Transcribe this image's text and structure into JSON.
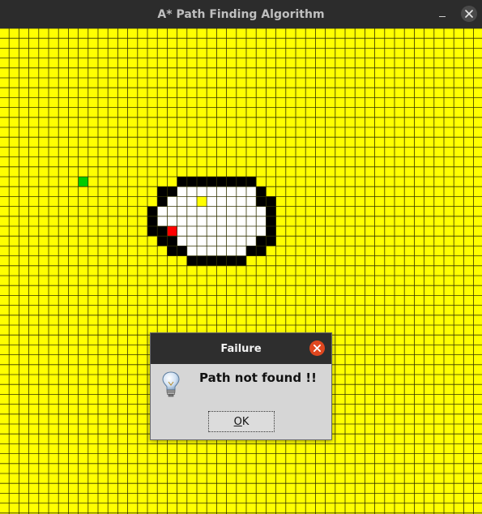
{
  "window": {
    "title": "A* Path Finding Algorithm",
    "minimize_icon": "minimize-icon",
    "close_icon": "close-icon"
  },
  "grid": {
    "cell_colors": {
      "empty": "#ffff00",
      "visited": "#ffffff",
      "wall": "#000000",
      "start": "#00cc00",
      "end": "#ff0000",
      "lines": "#333300"
    },
    "start_cell": [
      15,
      8
    ],
    "end_cell": [
      20,
      17
    ],
    "wall_rows": [
      {
        "row": 15,
        "cols": [
          18,
          19,
          20,
          21,
          22,
          23,
          24,
          25
        ]
      },
      {
        "row": 16,
        "cols": [
          16,
          17,
          26
        ]
      },
      {
        "row": 17,
        "cols": [
          16,
          26,
          27
        ]
      },
      {
        "row": 18,
        "cols": [
          15,
          27
        ]
      },
      {
        "row": 19,
        "cols": [
          15,
          27
        ]
      },
      {
        "row": 20,
        "cols": [
          15,
          16,
          27
        ]
      },
      {
        "row": 21,
        "cols": [
          16,
          17,
          26,
          27
        ]
      },
      {
        "row": 22,
        "cols": [
          17,
          18,
          25,
          26
        ]
      },
      {
        "row": 23,
        "cols": [
          19,
          20,
          21,
          22,
          23,
          24
        ]
      }
    ],
    "visited_rows": [
      {
        "row": 16,
        "cols": [
          18,
          19,
          20,
          21,
          22,
          23,
          24,
          25
        ]
      },
      {
        "row": 17,
        "cols": [
          17,
          18,
          19,
          21,
          22,
          23,
          24,
          25
        ]
      },
      {
        "row": 18,
        "cols": [
          16,
          17,
          18,
          19,
          20,
          21,
          22,
          23,
          24,
          25,
          26
        ]
      },
      {
        "row": 19,
        "cols": [
          16,
          17,
          18,
          19,
          20,
          21,
          22,
          23,
          24,
          25,
          26
        ]
      },
      {
        "row": 20,
        "cols": [
          17,
          18,
          19,
          20,
          21,
          22,
          23,
          24,
          25,
          26
        ]
      },
      {
        "row": 21,
        "cols": [
          18,
          19,
          20,
          21,
          22,
          23,
          24,
          25
        ]
      },
      {
        "row": 22,
        "cols": [
          19,
          20,
          21,
          22,
          23,
          24
        ]
      }
    ]
  },
  "dialog": {
    "title": "Failure",
    "message": "Path not found !!",
    "ok_label_mnemonic": "O",
    "ok_label_rest": "K",
    "icon": "lightbulb-icon",
    "close_icon": "close-icon",
    "close_color": "#e0471f"
  }
}
